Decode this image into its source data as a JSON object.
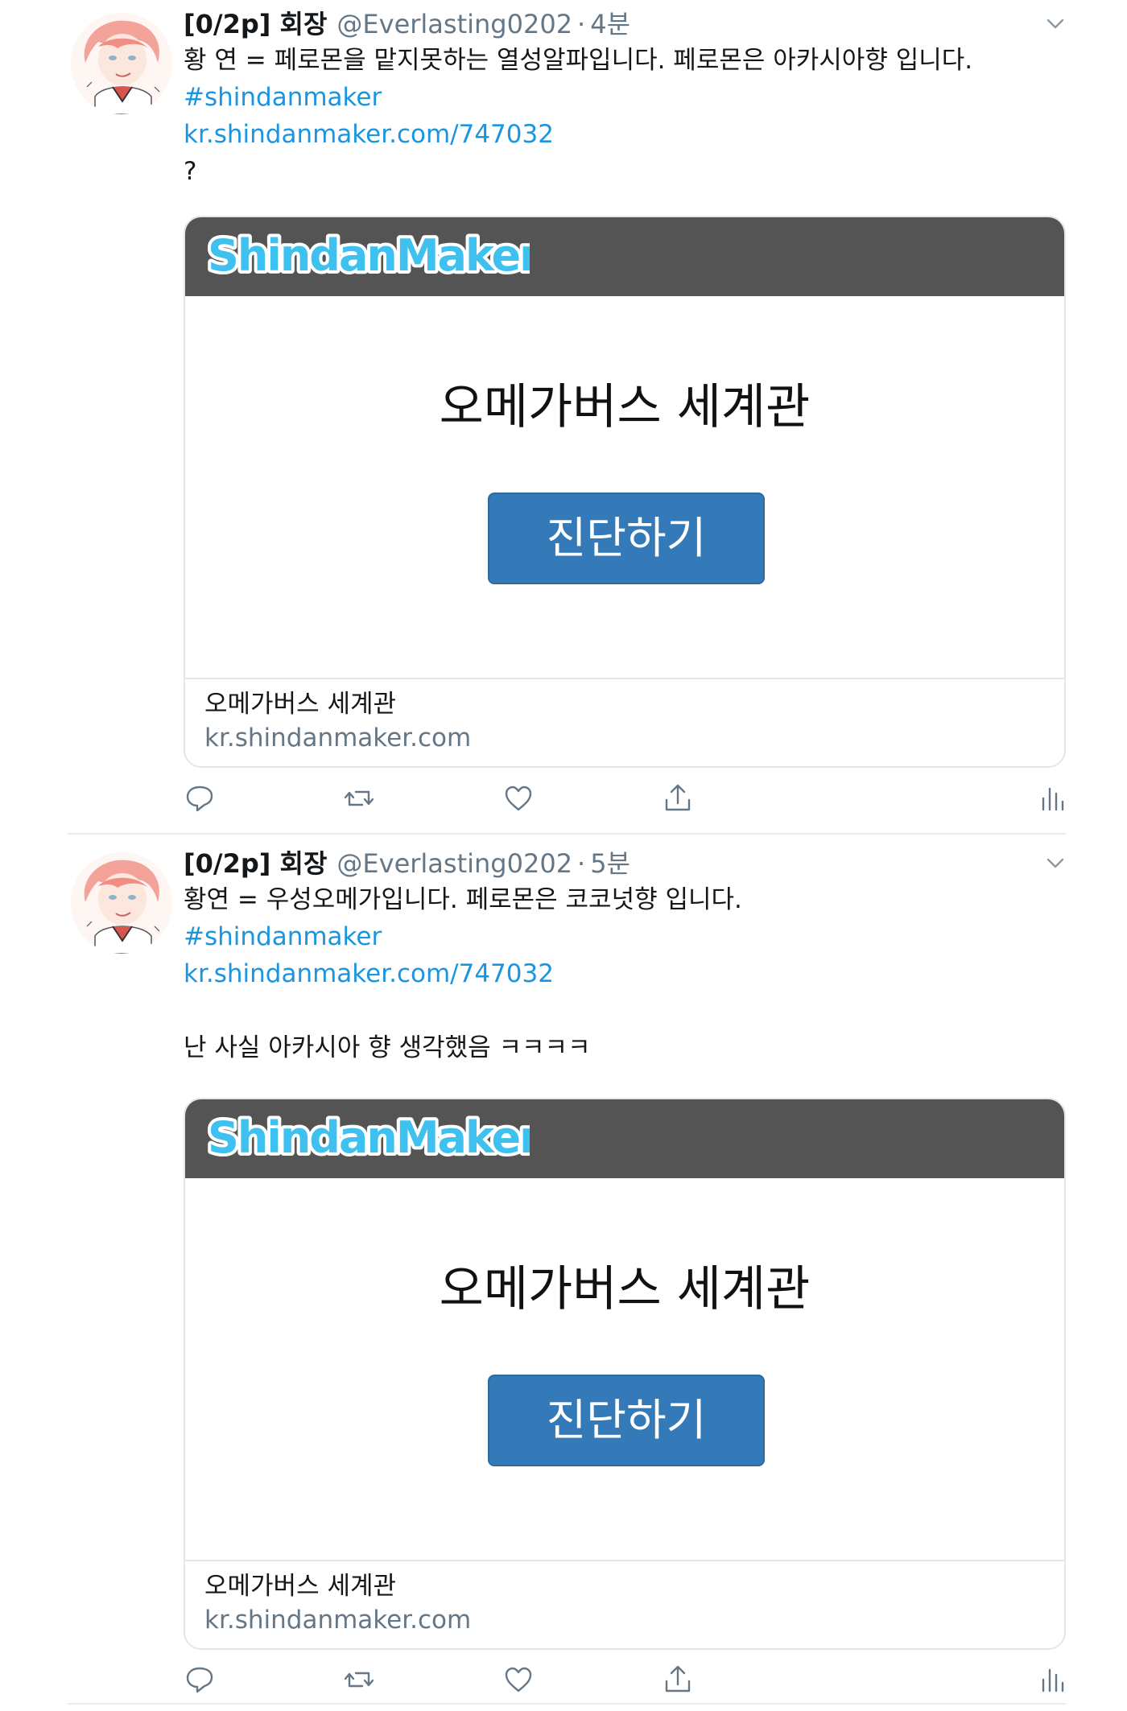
{
  "tweets": [
    {
      "author_name": "[0/2p] 회장",
      "handle": "@Everlasting0202",
      "separator": "·",
      "time": "4분",
      "lines": [
        "황 연 = 페로몬을 맡지못하는 열성알파입니다. 페로몬은 아카시아향 입니다."
      ],
      "hashtag": "#shindanmaker",
      "url": "kr.shindanmaker.com/747032",
      "after_link_lines": [
        "?"
      ],
      "card": {
        "logo_text": "ShindanMaker",
        "heading": "오메가버스 세계관",
        "button_label": "진단하기",
        "title": "오메가버스 세계관",
        "domain": "kr.shindanmaker.com"
      }
    },
    {
      "author_name": "[0/2p] 회장",
      "handle": "@Everlasting0202",
      "separator": "·",
      "time": "5분",
      "lines": [
        "황연 = 우성오메가입니다. 페로몬은 코코넛향 입니다."
      ],
      "hashtag": "#shindanmaker",
      "url": "kr.shindanmaker.com/747032",
      "after_link_lines": [
        "",
        "난 사실 아카시아 향 생각했음 ㅋㅋㅋㅋ"
      ],
      "card": {
        "logo_text": "ShindanMaker",
        "heading": "오메가버스 세계관",
        "button_label": "진단하기",
        "title": "오메가버스 세계관",
        "domain": "kr.shindanmaker.com"
      }
    }
  ],
  "action_icons": [
    "reply-icon",
    "retweet-icon",
    "like-icon",
    "share-icon",
    "analytics-icon"
  ],
  "colors": {
    "link": "#1b95e0",
    "muted": "#657786",
    "banner": "#545454",
    "logo": "#3fc1f0",
    "button": "#347ab8",
    "divider": "#e6ecf0"
  }
}
